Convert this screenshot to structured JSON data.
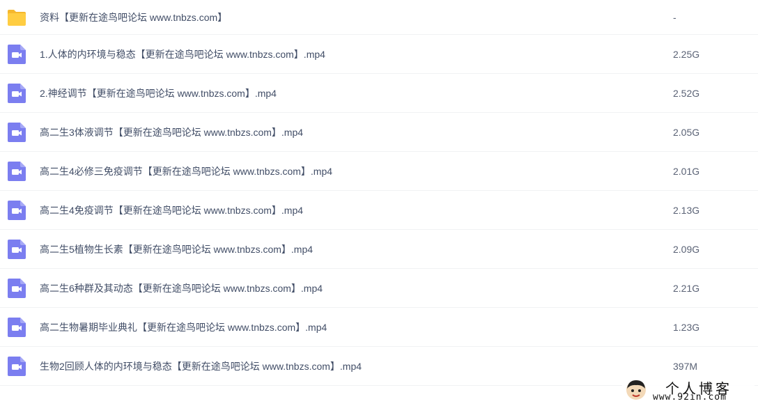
{
  "colors": {
    "folder": "#ffcd42",
    "folder_back": "#f5b82e",
    "video": "#7b7ef0",
    "text": "#424e67",
    "divider": "#f1f2f4"
  },
  "files": [
    {
      "icon": "folder-icon",
      "name": "资料【更新在途鸟吧论坛 www.tnbzs.com】",
      "size": "-"
    },
    {
      "icon": "video-file-icon",
      "name": "1.人体的内环境与稳态【更新在途鸟吧论坛 www.tnbzs.com】.mp4",
      "size": "2.25G"
    },
    {
      "icon": "video-file-icon",
      "name": "2.神经调节【更新在途鸟吧论坛 www.tnbzs.com】.mp4",
      "size": "2.52G"
    },
    {
      "icon": "video-file-icon",
      "name": "高二生3体液调节【更新在途鸟吧论坛 www.tnbzs.com】.mp4",
      "size": "2.05G"
    },
    {
      "icon": "video-file-icon",
      "name": "高二生4必修三免疫调节【更新在途鸟吧论坛 www.tnbzs.com】.mp4",
      "size": "2.01G"
    },
    {
      "icon": "video-file-icon",
      "name": "高二生4免疫调节【更新在途鸟吧论坛 www.tnbzs.com】.mp4",
      "size": "2.13G"
    },
    {
      "icon": "video-file-icon",
      "name": "高二生5植物生长素【更新在途鸟吧论坛 www.tnbzs.com】.mp4",
      "size": "2.09G"
    },
    {
      "icon": "video-file-icon",
      "name": "高二生6种群及其动态【更新在途鸟吧论坛 www.tnbzs.com】.mp4",
      "size": "2.21G"
    },
    {
      "icon": "video-file-icon",
      "name": "高二生物暑期毕业典礼【更新在途鸟吧论坛 www.tnbzs.com】.mp4",
      "size": "1.23G"
    },
    {
      "icon": "video-file-icon",
      "name": "生物2回顾人体的内环境与稳态【更新在途鸟吧论坛 www.tnbzs.com】.mp4",
      "size": "397M"
    }
  ],
  "watermark": {
    "title": "个人博客",
    "site": "www.92in.com"
  }
}
